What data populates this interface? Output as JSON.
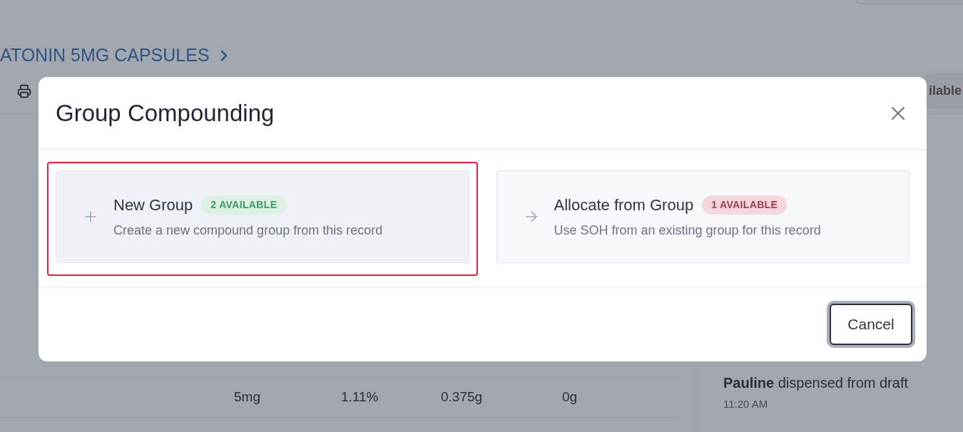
{
  "background": {
    "breadcrumb": "ATONIN 5MG CAPSULES",
    "side_button": "ilable",
    "table_row": [
      "5mg",
      "1.11%",
      "0.375g",
      "0g"
    ],
    "activity": {
      "actor": "Pauline",
      "action": "dispensed from draft",
      "time": "11:20 AM"
    }
  },
  "dialog": {
    "title": "Group Compounding",
    "options": [
      {
        "kind": "new",
        "title": "New Group",
        "badge": "2 AVAILABLE",
        "color": "#dcf1e4",
        "description": "Create a new compound group from this record",
        "selected": true
      },
      {
        "kind": "allocate",
        "title": "Allocate from Group",
        "badge": "1 AVAILABLE",
        "color": "#f4d6dd",
        "description": "Use SOH from an existing group for this record",
        "selected": false
      }
    ],
    "buttons": [
      "Cancel"
    ]
  }
}
